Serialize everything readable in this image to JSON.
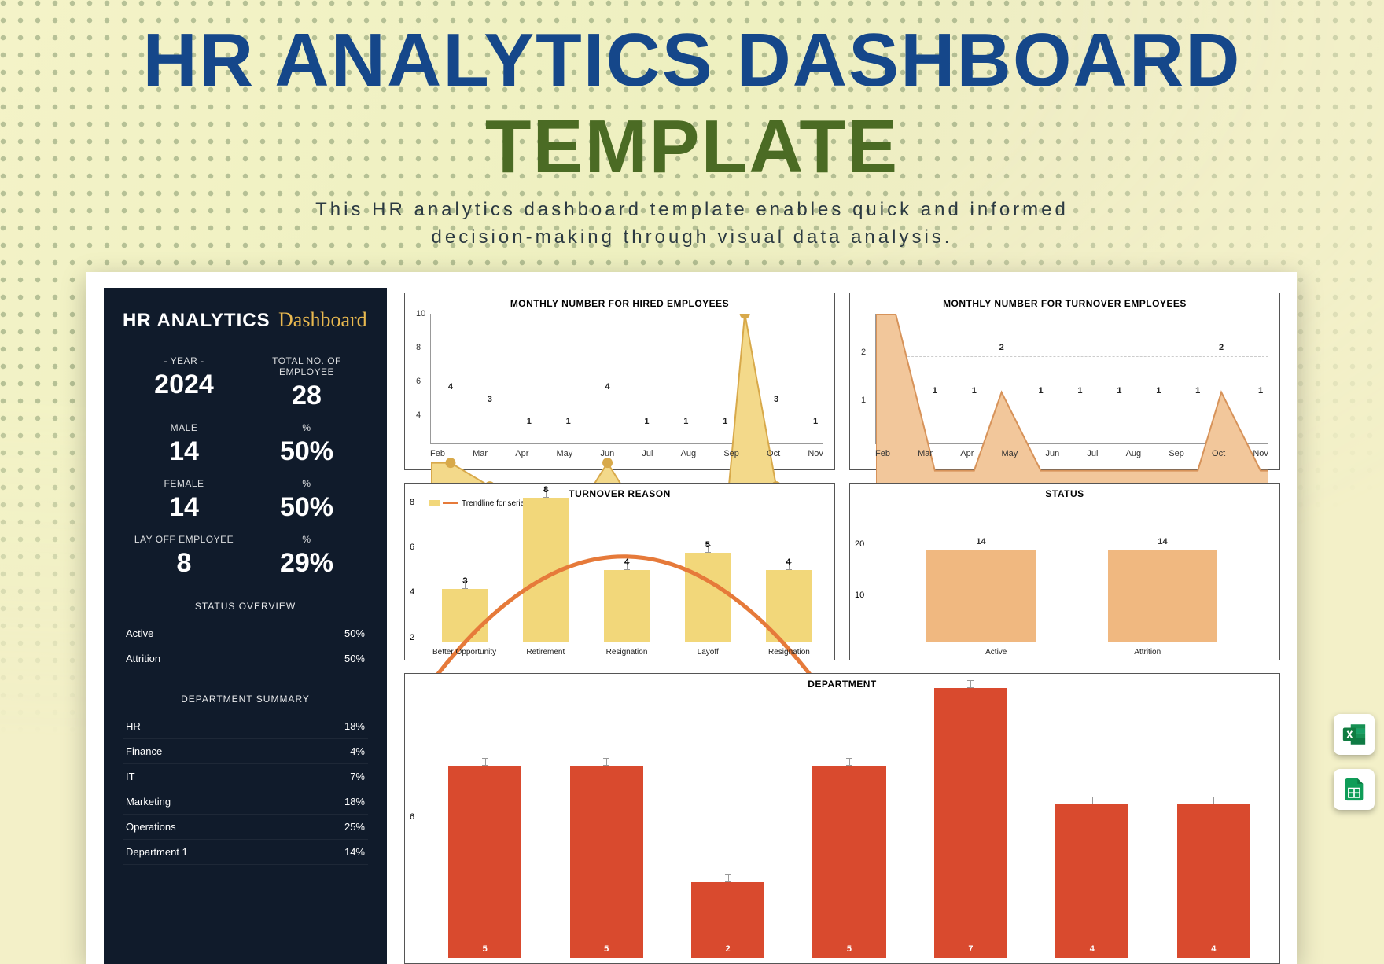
{
  "header": {
    "title_main": "HR ANALYTICS DASHBOARD ",
    "title_accent": "TEMPLATE",
    "subtitle_l1": "This HR analytics dashboard template enables quick and informed",
    "subtitle_l2": "decision-making through visual data analysis."
  },
  "sidebar": {
    "title": "HR ANALYTICS",
    "title_script": "Dashboard",
    "year_label": "- YEAR -",
    "year_value": "2024",
    "total_label": "TOTAL NO. OF EMPLOYEE",
    "total_value": "28",
    "male_label": "MALE",
    "male_value": "14",
    "male_pct_label": "%",
    "male_pct_value": "50%",
    "female_label": "FEMALE",
    "female_value": "14",
    "female_pct_label": "%",
    "female_pct_value": "50%",
    "layoff_label": "LAY OFF EMPLOYEE",
    "layoff_value": "8",
    "layoff_pct_label": "%",
    "layoff_pct_value": "29%",
    "status_head": "STATUS OVERVIEW",
    "status_rows": [
      {
        "name": "Active",
        "value": "50%"
      },
      {
        "name": "Attrition",
        "value": "50%"
      }
    ],
    "dept_head": "DEPARTMENT SUMMARY",
    "dept_rows": [
      {
        "name": "HR",
        "value": "18%"
      },
      {
        "name": "Finance",
        "value": "4%"
      },
      {
        "name": "IT",
        "value": "7%"
      },
      {
        "name": "Marketing",
        "value": "18%"
      },
      {
        "name": "Operations",
        "value": "25%"
      },
      {
        "name": "Department 1",
        "value": "14%"
      }
    ]
  },
  "charts": {
    "hired_title": "MONTHLY NUMBER FOR HIRED EMPLOYEES",
    "turnover_title": "MONTHLY NUMBER FOR TURNOVER EMPLOYEES",
    "reason_title": "TURNOVER REASON",
    "reason_legend": "Trendline for series 1",
    "status_title": "STATUS",
    "dept_title": "DEPARTMENT"
  },
  "chart_data": [
    {
      "id": "hired",
      "type": "area",
      "title": "MONTHLY NUMBER FOR HIRED EMPLOYEES",
      "categories": [
        "Feb",
        "Mar",
        "Apr",
        "May",
        "Jun",
        "Jul",
        "Aug",
        "Sep",
        "Oct",
        "Nov"
      ],
      "values": [
        4,
        3,
        1,
        1,
        4,
        1,
        1,
        1,
        11,
        3,
        1
      ],
      "ylim": [
        0,
        11
      ],
      "yticks": [
        4,
        6,
        8,
        10
      ]
    },
    {
      "id": "turnover",
      "type": "area",
      "title": "MONTHLY NUMBER FOR TURNOVER EMPLOYEES",
      "categories": [
        "Feb",
        "Mar",
        "Apr",
        "May",
        "Jun",
        "Jul",
        "Aug",
        "Sep",
        "Oct",
        "Nov"
      ],
      "values": [
        3,
        1,
        1,
        2,
        1,
        1,
        1,
        1,
        1,
        2,
        1
      ],
      "ylim": [
        0,
        3
      ],
      "yticks": [
        1,
        2
      ]
    },
    {
      "id": "reason",
      "type": "bar",
      "title": "TURNOVER REASON",
      "categories": [
        "Better Opportunity",
        "Retirement",
        "Resignation",
        "Layoff",
        "Resignation"
      ],
      "values": [
        3,
        8,
        4,
        5,
        4
      ],
      "ylim": [
        0,
        8
      ],
      "yticks": [
        2,
        4,
        6,
        8
      ],
      "trendline": true
    },
    {
      "id": "status",
      "type": "bar",
      "title": "STATUS",
      "categories": [
        "Active",
        "Attrition"
      ],
      "values": [
        14,
        14
      ],
      "ylim": [
        0,
        22
      ],
      "yticks": [
        10,
        20
      ]
    },
    {
      "id": "department",
      "type": "bar",
      "title": "DEPARTMENT",
      "categories": [
        "",
        "",
        "",
        "",
        "",
        "",
        ""
      ],
      "values": [
        5,
        5,
        2,
        5,
        7,
        4,
        4
      ],
      "ylim": [
        0,
        7
      ],
      "yticks": [
        6
      ]
    }
  ]
}
